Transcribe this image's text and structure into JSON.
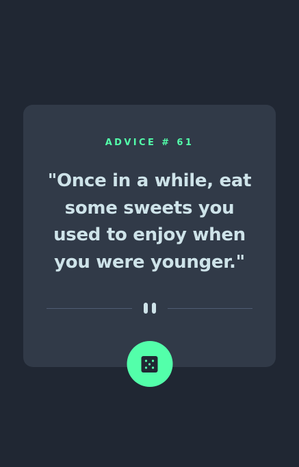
{
  "card": {
    "advice_label": "ADVICE # 61",
    "quote": "\"Once in a while, eat some sweets you used to enjoy when you were younger.\""
  },
  "divider": {
    "icon": "pause-icon"
  },
  "actions": {
    "dice_icon": "dice-icon"
  },
  "colors": {
    "background": "#202733",
    "card": "#313a48",
    "accent": "#53ffaa",
    "text": "#cee3e9",
    "divider": "#4f5d74"
  }
}
